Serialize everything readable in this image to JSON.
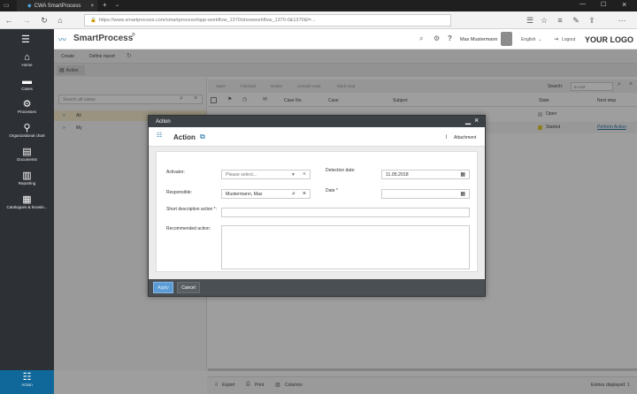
{
  "browser": {
    "tab_title": "CWA SmartProcess",
    "url": "https://www.smartprocess.com/smartprocess#app-workflow_1370/showworkflow_1370-0&1370&f=..."
  },
  "sidebar": {
    "items": [
      {
        "label": "Home",
        "icon": "house-icon"
      },
      {
        "label": "Cases",
        "icon": "folder-icon"
      },
      {
        "label": "Processes",
        "icon": "process-icon"
      },
      {
        "label": "Organizational chart",
        "icon": "org-chart-icon"
      },
      {
        "label": "Documents",
        "icon": "document-icon"
      },
      {
        "label": "Reporting",
        "icon": "chart-icon"
      },
      {
        "label": "Catalogues & knowle...",
        "icon": "catalogue-icon"
      },
      {
        "label": "Action",
        "icon": "action-list-icon"
      }
    ]
  },
  "header": {
    "brand": "SmartProcess",
    "brand_sup": "®",
    "user": "Max Mustermann",
    "language": "English",
    "logout": "Logout",
    "logo": "YOUR LOGO"
  },
  "toolbar": {
    "create": "Create",
    "define_report": "Define report"
  },
  "tabrow": {
    "tab": "Action"
  },
  "leftpanel": {
    "search_placeholder": "Search all cases",
    "items": [
      {
        "label": "All"
      },
      {
        "label": "My"
      }
    ]
  },
  "grid": {
    "actions": [
      "Open",
      "Finished",
      "Delete",
      "Unmark read",
      "Mark read"
    ],
    "search_label": "Search:",
    "search_value": "In List",
    "columns": [
      "Case No.",
      "Case",
      "Subject",
      "State",
      "Next step"
    ],
    "rows": [
      {
        "state": "Open",
        "state_color": "#c8c8c8",
        "next": ""
      },
      {
        "state": "Started",
        "state_color": "#e6c619",
        "next": "Perform Action"
      }
    ]
  },
  "bottombar": {
    "export": "Export",
    "print": "Print",
    "columns": "Columns",
    "entries": "Entries displayed: 1"
  },
  "modal": {
    "title": "Action",
    "heading": "Action",
    "attachment": "Attachment",
    "fields": {
      "activator_label": "Activator:",
      "activator_value": "Please select...",
      "responsible_label": "Responsible:",
      "responsible_value": "Mustermann, Max",
      "detection_label": "Detection date:",
      "detection_value": "11.05.2018",
      "date_label": "Date *",
      "date_value": "",
      "short_desc_label": "Short description action *:",
      "recommended_label": "Recommended action:"
    },
    "ok": "Apply",
    "cancel": "Cancel"
  },
  "colors": {
    "accent": "#10689a",
    "sidebar": "#2d3035",
    "modal_title": "#3c4146"
  }
}
